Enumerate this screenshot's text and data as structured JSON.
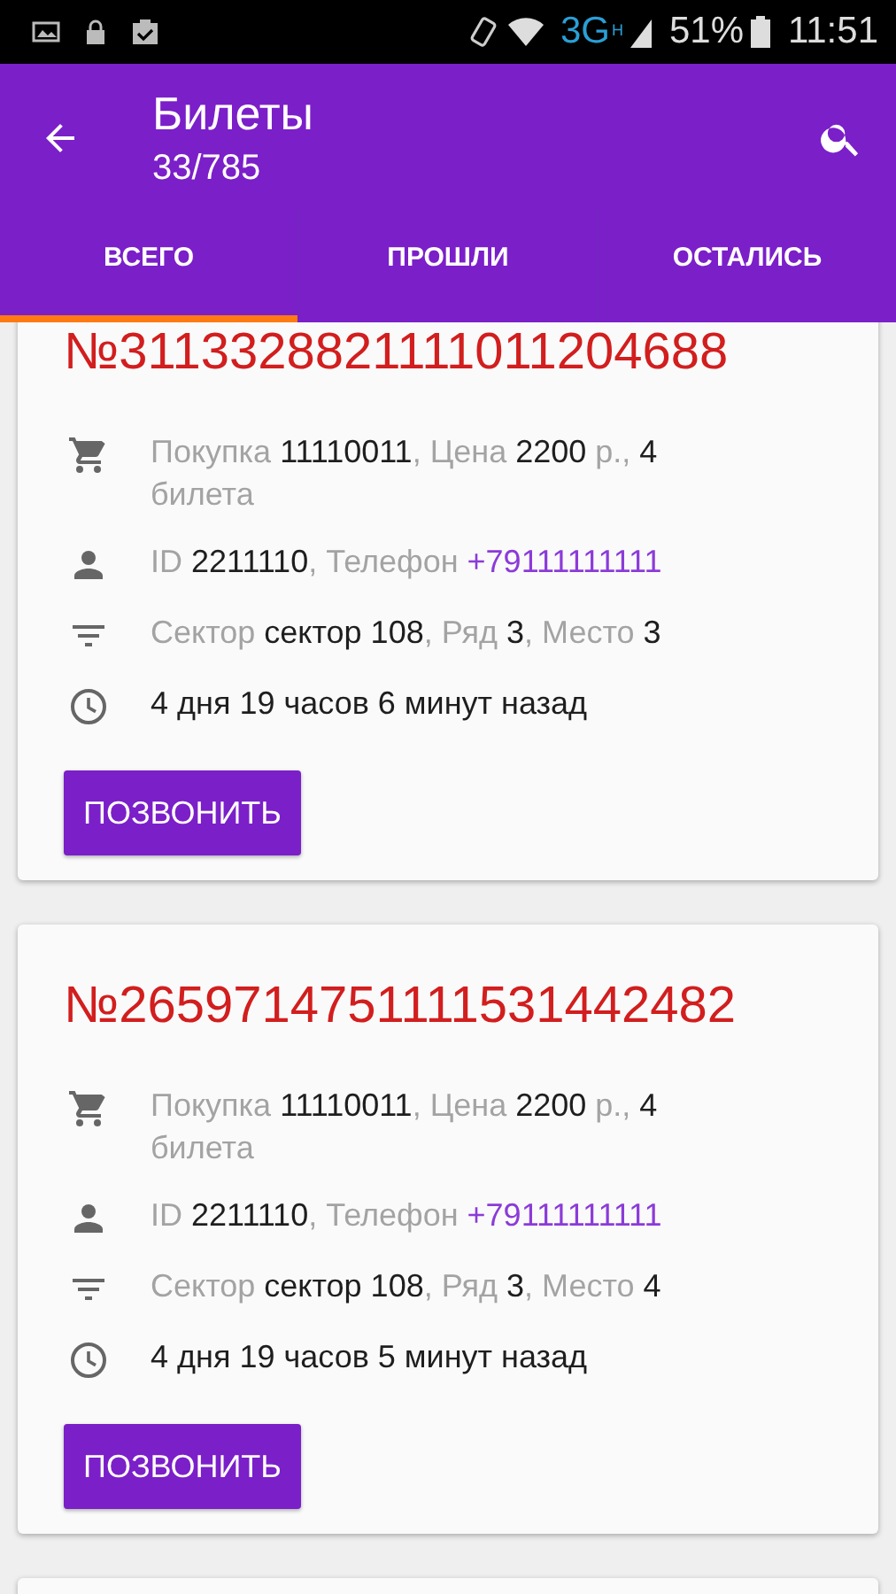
{
  "status_bar": {
    "network": "3G",
    "network_sub": "H",
    "battery": "51%",
    "time": "11:51"
  },
  "app_bar": {
    "title": "Билеты",
    "subtitle": "33/785"
  },
  "tabs": [
    {
      "label": "ВСЕГО",
      "selected": true
    },
    {
      "label": "ПРОШЛИ",
      "selected": false
    },
    {
      "label": "ОСТАЛИСЬ",
      "selected": false
    }
  ],
  "tickets": [
    {
      "number": "№3113328821111011204688",
      "details": [
        {
          "kind": "purchase",
          "parts": [
            {
              "kind": "label",
              "text": "Покупка "
            },
            {
              "kind": "value",
              "text": "11110011"
            },
            {
              "kind": "label",
              "text": ", Цена "
            },
            {
              "kind": "value",
              "text": "2200"
            },
            {
              "kind": "label",
              "text": " р., "
            },
            {
              "kind": "value",
              "text": "4"
            },
            {
              "kind": "label",
              "text": " билета"
            }
          ]
        },
        {
          "kind": "customer",
          "parts": [
            {
              "kind": "label",
              "text": "ID "
            },
            {
              "kind": "value",
              "text": "2211110"
            },
            {
              "kind": "label",
              "text": ", Телефон "
            },
            {
              "kind": "link",
              "text": "+79111111111"
            }
          ]
        },
        {
          "kind": "seat",
          "parts": [
            {
              "kind": "label",
              "text": "Сектор "
            },
            {
              "kind": "value",
              "text": "сектор 108"
            },
            {
              "kind": "label",
              "text": ", Ряд "
            },
            {
              "kind": "value",
              "text": "3"
            },
            {
              "kind": "label",
              "text": ", Место "
            },
            {
              "kind": "value",
              "text": "3"
            }
          ]
        },
        {
          "kind": "time",
          "parts": [
            {
              "kind": "value",
              "text": "4 дня 19 часов 6 минут назад"
            }
          ]
        }
      ],
      "button": "ПОЗВОНИТЬ"
    },
    {
      "number": "№2659714751111531442482",
      "details": [
        {
          "kind": "purchase",
          "parts": [
            {
              "kind": "label",
              "text": "Покупка "
            },
            {
              "kind": "value",
              "text": "11110011"
            },
            {
              "kind": "label",
              "text": ", Цена "
            },
            {
              "kind": "value",
              "text": "2200"
            },
            {
              "kind": "label",
              "text": " р., "
            },
            {
              "kind": "value",
              "text": "4"
            },
            {
              "kind": "label",
              "text": " билета"
            }
          ]
        },
        {
          "kind": "customer",
          "parts": [
            {
              "kind": "label",
              "text": "ID "
            },
            {
              "kind": "value",
              "text": "2211110"
            },
            {
              "kind": "label",
              "text": ", Телефон "
            },
            {
              "kind": "link",
              "text": "+79111111111"
            }
          ]
        },
        {
          "kind": "seat",
          "parts": [
            {
              "kind": "label",
              "text": "Сектор "
            },
            {
              "kind": "value",
              "text": "сектор 108"
            },
            {
              "kind": "label",
              "text": ", Ряд "
            },
            {
              "kind": "value",
              "text": "3"
            },
            {
              "kind": "label",
              "text": ", Место "
            },
            {
              "kind": "value",
              "text": "4"
            }
          ]
        },
        {
          "kind": "time",
          "parts": [
            {
              "kind": "value",
              "text": "4 дня 19 часов 5 минут назад"
            }
          ]
        }
      ],
      "button": "ПОЗВОНИТЬ"
    }
  ]
}
